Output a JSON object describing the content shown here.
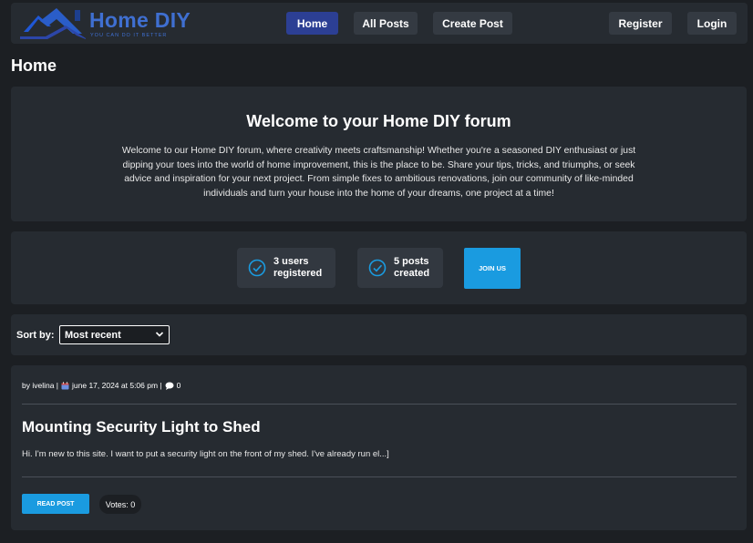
{
  "brand": {
    "name": "Home DIY",
    "tagline": "YOU CAN DO IT BETTER"
  },
  "nav": {
    "home": "Home",
    "all_posts": "All Posts",
    "create_post": "Create Post",
    "register": "Register",
    "login": "Login"
  },
  "page_title": "Home",
  "welcome": {
    "title": "Welcome to your Home DIY forum",
    "text": "Welcome to our Home DIY forum, where creativity meets craftsmanship! Whether you're a seasoned DIY enthusiast or just dipping your toes into the world of home improvement, this is the place to be. Share your tips, tricks, and triumphs, or seek advice and inspiration for your next project. From simple fixes to ambitious renovations, join our community of like-minded individuals and turn your house into the home of your dreams, one project at a time!"
  },
  "stats": {
    "users_line1": "3 users",
    "users_line2": "registered",
    "posts_line1": "5 posts",
    "posts_line2": "created",
    "join_label": "JOIN US"
  },
  "sort": {
    "label": "Sort by:",
    "selected": "Most recent"
  },
  "post": {
    "meta_author": "by ivelina |",
    "meta_date": "june 17, 2024 at 5:06 pm |",
    "meta_comments": "0",
    "title": "Mounting Security Light to Shed",
    "excerpt": "Hi. I'm new to this site. I want to put a security light on the front of my shed. I've already run el...]",
    "read_label": "READ POST",
    "votes": "Votes: 0"
  },
  "colors": {
    "accent": "#1a9be0",
    "nav_active": "#2c3f94",
    "brand": "#3f6fd1",
    "background": "#1c1f23",
    "card": "#262b31"
  }
}
